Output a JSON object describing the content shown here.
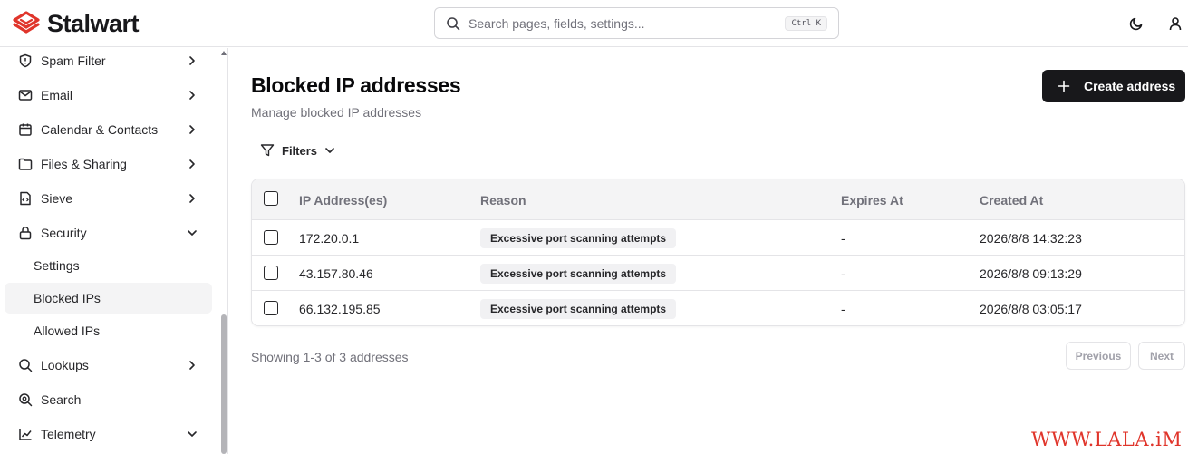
{
  "brand": {
    "name": "Stalwart",
    "accent": "#e0352b"
  },
  "search": {
    "placeholder": "Search pages, fields, settings...",
    "value": "",
    "shortcut": "Ctrl K"
  },
  "header_icons": [
    "moon-icon",
    "user-icon"
  ],
  "sidebar": {
    "items": [
      {
        "label": "Spam Filter",
        "icon": "shield-icon",
        "expanded": false
      },
      {
        "label": "Email",
        "icon": "mail-icon",
        "expanded": false
      },
      {
        "label": "Calendar & Contacts",
        "icon": "calendar-icon",
        "expanded": false
      },
      {
        "label": "Files & Sharing",
        "icon": "folder-icon",
        "expanded": false
      },
      {
        "label": "Sieve",
        "icon": "file-code-icon",
        "expanded": false
      },
      {
        "label": "Security",
        "icon": "lock-icon",
        "expanded": true
      },
      {
        "label": "Lookups",
        "icon": "search-icon",
        "expanded": false
      },
      {
        "label": "Search",
        "icon": "zoom-search-icon",
        "expanded": false
      },
      {
        "label": "Telemetry",
        "icon": "chart-icon",
        "expanded": true
      }
    ],
    "security_subitems": [
      {
        "label": "Settings",
        "active": false
      },
      {
        "label": "Blocked IPs",
        "active": true
      },
      {
        "label": "Allowed IPs",
        "active": false
      }
    ]
  },
  "page": {
    "title": "Blocked IP addresses",
    "subtitle": "Manage blocked IP addresses",
    "create_label": "Create address",
    "filters_label": "Filters"
  },
  "table": {
    "columns": [
      "IP Address(es)",
      "Reason",
      "Expires At",
      "Created At"
    ],
    "rows": [
      {
        "ip": "172.20.0.1",
        "reason": "Excessive port scanning attempts",
        "expires": "-",
        "created": "2026/8/8 14:32:23"
      },
      {
        "ip": "43.157.80.46",
        "reason": "Excessive port scanning attempts",
        "expires": "-",
        "created": "2026/8/8 09:13:29"
      },
      {
        "ip": "66.132.195.85",
        "reason": "Excessive port scanning attempts",
        "expires": "-",
        "created": "2026/8/8 03:05:17"
      }
    ]
  },
  "pagination": {
    "summary": "Showing 1-3 of 3 addresses",
    "previous": "Previous",
    "next": "Next"
  },
  "watermark": "WWW.LALA.iM"
}
